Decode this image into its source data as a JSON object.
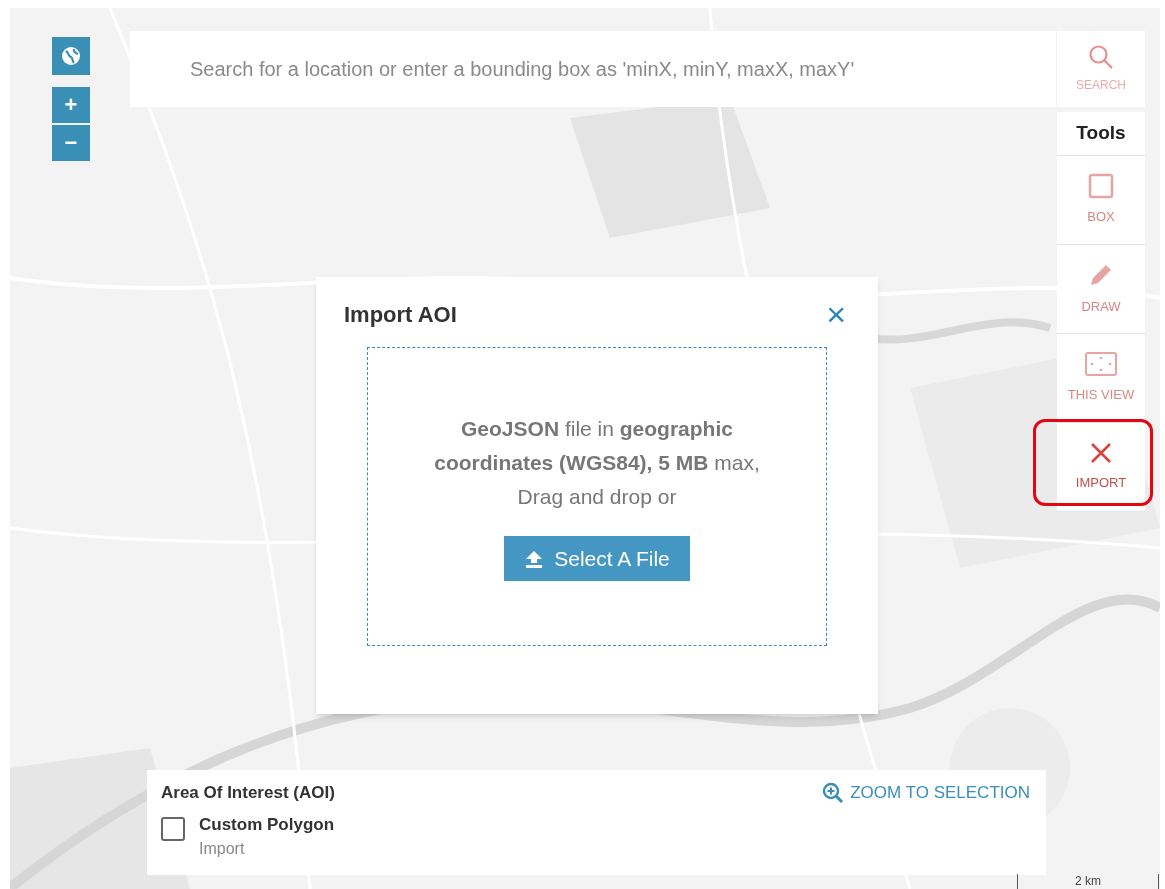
{
  "map_controls": [
    {
      "kind": "globe"
    },
    {
      "kind": "zoom_in",
      "label": "+"
    },
    {
      "kind": "zoom_out",
      "label": "−"
    }
  ],
  "search": {
    "placeholder": "Search for a location or enter a bounding box as 'minX, minY, maxX, maxY'",
    "button": "SEARCH"
  },
  "tools": {
    "title": "Tools",
    "items": [
      {
        "kind": "box",
        "label": "BOX",
        "active": false,
        "highlighted": false
      },
      {
        "kind": "draw",
        "label": "DRAW",
        "active": false,
        "highlighted": false
      },
      {
        "kind": "view",
        "label": "THIS VIEW",
        "active": false,
        "highlighted": false
      },
      {
        "kind": "import",
        "label": "IMPORT",
        "active": true,
        "highlighted": true
      }
    ]
  },
  "dialog": {
    "title": "Import AOI",
    "close": "×",
    "drop_text": "**GeoJSON** file in **geographic coordinates (WGS84), 5 MB** max, Drag and drop or",
    "button": "Select A File"
  },
  "aoi_panel": {
    "title": "Area Of Interest (AOI)",
    "zoom_link": "ZOOM TO SELECTION",
    "items": [
      {
        "name": "Custom Polygon",
        "source": "Import",
        "checked": false
      }
    ]
  },
  "scale": {
    "label": "2 km"
  }
}
